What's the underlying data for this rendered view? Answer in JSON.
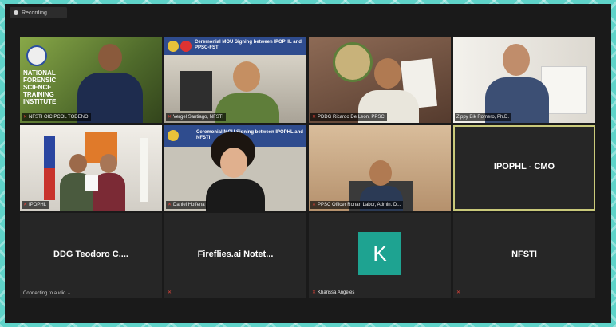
{
  "recording": {
    "label": "Recording..."
  },
  "colors": {
    "accent_mic": "#e0443a",
    "avatar_bg": "#1ea391",
    "active_border": "#c9c97a"
  },
  "tiles": [
    {
      "name": "NFSTI OIC PCOL TODENO",
      "banner": "NATIONAL FORENSIC SCIENCE TRAINING INSTITUTE",
      "muted": true
    },
    {
      "name": "Vergel Santiago, NFSTI",
      "banner": "Ceremonial MOU Signing between IPOPHL and PPSC-FSTI",
      "muted": true
    },
    {
      "name": "PDDG Ricardo De Leon, PPSC",
      "muted": true
    },
    {
      "name": "Zippy Bik Romero, Ph.D.",
      "muted": false
    },
    {
      "name": "IPOPHL",
      "muted": true
    },
    {
      "name": "Daniel Hoffena",
      "banner": "Ceremonial MOU Signing between IPOPHL and NFSTI",
      "muted": true
    },
    {
      "name": "PPSC Officer Ronan Labor, Admin. D...",
      "muted": true
    },
    {
      "label": "IPOPHL - CMO"
    },
    {
      "label": "DDG Teodoro C....",
      "status": "Connecting to audio"
    },
    {
      "label": "Fireflies.ai Notet...",
      "muted": true
    },
    {
      "name": "Kharissa Angeles",
      "initial": "K",
      "muted": true
    },
    {
      "label": "NFSTI",
      "muted": true
    }
  ]
}
